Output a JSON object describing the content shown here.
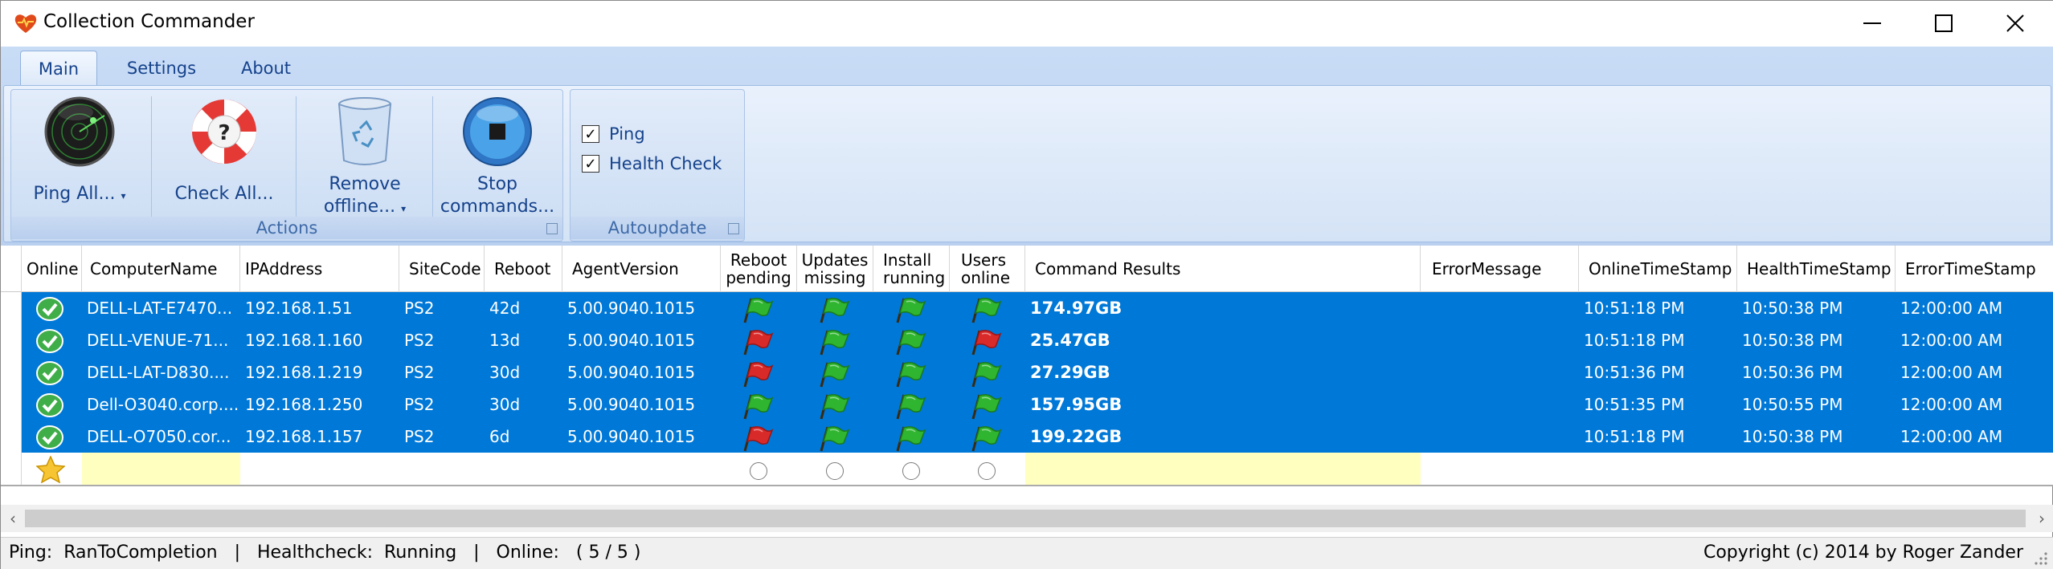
{
  "window": {
    "title": "Collection Commander"
  },
  "tabs": [
    {
      "label": "Main",
      "active": true
    },
    {
      "label": "Settings",
      "active": false
    },
    {
      "label": "About",
      "active": false
    }
  ],
  "ribbon": {
    "actions_group": "Actions",
    "autoupdate_group": "Autoupdate",
    "buttons": [
      {
        "label": "Ping All...",
        "icon": "radar-icon"
      },
      {
        "label": "Check All...",
        "icon": "lifebuoy-help-icon"
      },
      {
        "label_line1": "Remove",
        "label_line2": "offline...",
        "icon": "recycle-bin-icon"
      },
      {
        "label_line1": "Stop",
        "label_line2": "commands...",
        "icon": "stop-icon"
      }
    ],
    "checkboxes": [
      {
        "label": "Ping",
        "checked": true
      },
      {
        "label": "Health Check",
        "checked": true
      }
    ]
  },
  "grid": {
    "columns": {
      "online": "Online",
      "computer": "ComputerName",
      "ip": "IPAddress",
      "site": "SiteCode",
      "reboot": "Reboot",
      "agent": "AgentVersion",
      "reboot_pending_1": "Reboot",
      "reboot_pending_2": "pending",
      "updates_missing_1": "Updates",
      "updates_missing_2": "missing",
      "install_running_1": "Install",
      "install_running_2": "running",
      "users_online_1": "Users",
      "users_online_2": "online",
      "results": "Command Results",
      "error": "ErrorMessage",
      "online_ts": "OnlineTimeStamp",
      "health_ts": "HealthTimeStamp",
      "error_ts": "ErrorTimeStamp"
    },
    "rows": [
      {
        "computer": "DELL-LAT-E7470...",
        "ip": "192.168.1.51",
        "site": "PS2",
        "reboot": "42d",
        "agent": "5.00.9040.1015",
        "flags": [
          "green",
          "green",
          "green",
          "green"
        ],
        "results": "174.97GB",
        "error": "",
        "online_ts": "10:51:18 PM",
        "health_ts": "10:50:38 PM",
        "error_ts": "12:00:00 AM"
      },
      {
        "computer": "DELL-VENUE-71...",
        "ip": "192.168.1.160",
        "site": "PS2",
        "reboot": "13d",
        "agent": "5.00.9040.1015",
        "flags": [
          "red",
          "green",
          "green",
          "red"
        ],
        "results": "25.47GB",
        "error": "",
        "online_ts": "10:51:18 PM",
        "health_ts": "10:50:38 PM",
        "error_ts": "12:00:00 AM"
      },
      {
        "computer": "DELL-LAT-D830....",
        "ip": "192.168.1.219",
        "site": "PS2",
        "reboot": "30d",
        "agent": "5.00.9040.1015",
        "flags": [
          "red",
          "green",
          "green",
          "green"
        ],
        "results": "27.29GB",
        "error": "",
        "online_ts": "10:51:36 PM",
        "health_ts": "10:50:36 PM",
        "error_ts": "12:00:00 AM"
      },
      {
        "computer": "Dell-O3040.corp....",
        "ip": "192.168.1.250",
        "site": "PS2",
        "reboot": "30d",
        "agent": "5.00.9040.1015",
        "flags": [
          "green",
          "green",
          "green",
          "green"
        ],
        "results": "157.95GB",
        "error": "",
        "online_ts": "10:51:35 PM",
        "health_ts": "10:50:55 PM",
        "error_ts": "12:00:00 AM"
      },
      {
        "computer": "DELL-O7050.cor...",
        "ip": "192.168.1.157",
        "site": "PS2",
        "reboot": "6d",
        "agent": "5.00.9040.1015",
        "flags": [
          "red",
          "green",
          "green",
          "green"
        ],
        "results": "199.22GB",
        "error": "",
        "online_ts": "10:51:18 PM",
        "health_ts": "10:50:38 PM",
        "error_ts": "12:00:00 AM"
      }
    ]
  },
  "status": {
    "left": "Ping:  RanToCompletion   |   Healthcheck:  Running   |   Online:   ( 5 / 5 )",
    "right": "Copyright (c) 2014 by Roger Zander"
  },
  "colors": {
    "selection": "#0078d7",
    "flag_green": "#2fb52f",
    "flag_red": "#d92a2a",
    "new_row_yellow": "#ffffc0"
  }
}
